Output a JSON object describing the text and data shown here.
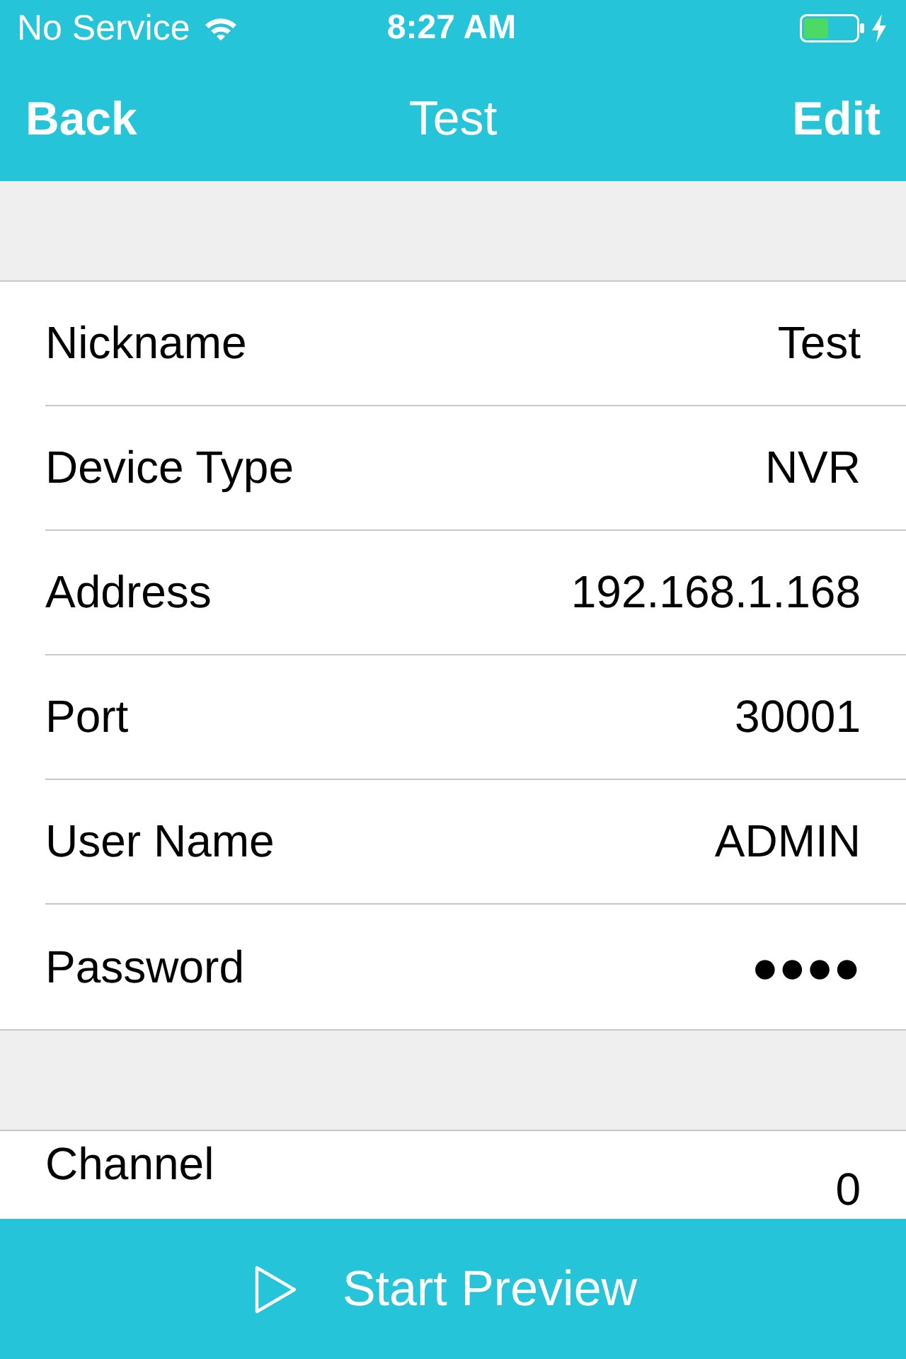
{
  "status_bar": {
    "carrier": "No Service",
    "time": "8:27 AM"
  },
  "nav_bar": {
    "back": "Back",
    "title": "Test",
    "edit": "Edit"
  },
  "sections": [
    {
      "rows": [
        {
          "label": "Nickname",
          "value": "Test"
        },
        {
          "label": "Device Type",
          "value": "NVR"
        },
        {
          "label": "Address",
          "value": "192.168.1.168"
        },
        {
          "label": "Port",
          "value": "30001"
        },
        {
          "label": "User Name",
          "value": "ADMIN"
        },
        {
          "label": "Password",
          "value": "●●●●"
        }
      ]
    },
    {
      "rows": [
        {
          "label": "Channel",
          "value": "0"
        }
      ]
    }
  ],
  "start_button": {
    "label": "Start Preview"
  }
}
